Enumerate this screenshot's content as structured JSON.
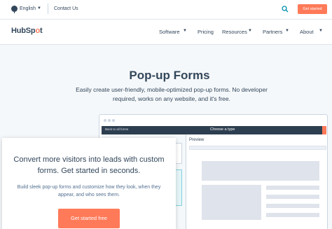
{
  "topbar": {
    "language": "English",
    "contact": "Contact Us",
    "cta": "Get started",
    "icons": [
      "globe-icon",
      "chevron-down-icon",
      "search-icon"
    ]
  },
  "nav": {
    "logo": {
      "prefix": "HubSp",
      "accent": "o",
      "suffix": "t"
    },
    "items": [
      "Software",
      "Pricing",
      "Resources",
      "Partners",
      "About"
    ]
  },
  "hero": {
    "title": "Pop-up Forms",
    "description": "Easily create user-friendly, mobile-optimized pop-up forms. No developer required, works on any website, and it's free."
  },
  "mockup": {
    "back_link": "Back to all forms",
    "header": "Choose a type",
    "preview_label": "Preview"
  },
  "overlay": {
    "title": "Convert more visitors into leads with custom forms. Get started in seconds.",
    "description": "Build sleek pop-up forms and customize how they look, when they appear, and who sees them.",
    "cta": "Get started free"
  },
  "colors": {
    "accent": "#ff7a59",
    "text": "#33475b",
    "background": "#f5f8fa",
    "app_bar": "#2d3e50"
  }
}
